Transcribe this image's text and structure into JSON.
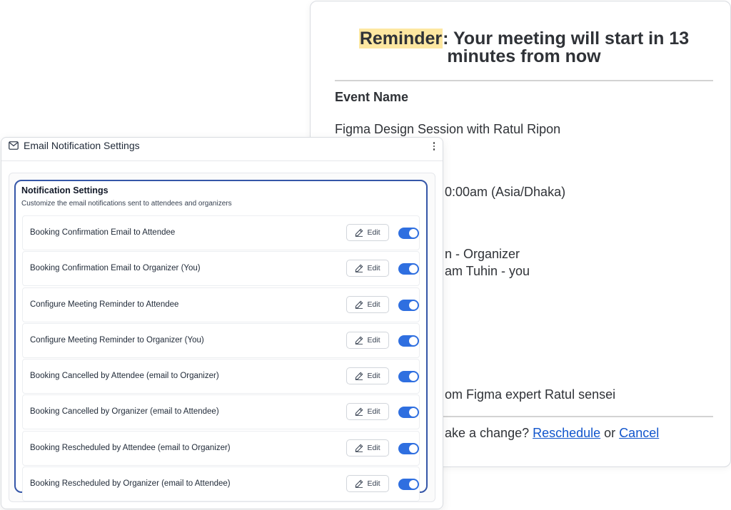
{
  "email_preview": {
    "heading_highlight": "Reminder",
    "heading_rest": ": Your meeting will start in 13",
    "heading_line2": "minutes from now",
    "event_label": "Event Name",
    "event_value": "Figma Design Session with Ratul Ripon",
    "time_fragment": "0:00am (Asia/Dhaka)",
    "organizer_fragment": "n - Organizer",
    "attendee_fragment": "am Tuhin - you",
    "description_fragment": "om Figma expert Ratul sensei",
    "change_prefix": "ake a change? ",
    "reschedule_link": "Reschedule",
    "or_text": " or ",
    "cancel_link": "Cancel",
    "highlight_color": "#fde7a1",
    "link_color": "#1155cc"
  },
  "settings_panel": {
    "title": "Email Notification Settings",
    "header_icon": "mail-icon",
    "menu_icon": "kebab-menu-icon",
    "section_title": "Notification Settings",
    "section_subtitle": "Customize the email notifications sent to attendees and organizers",
    "accent_color": "#3556a8",
    "toggle_color": "#2f6fe0",
    "edit_label": "Edit",
    "edit_icon": "pencil-icon",
    "rows": [
      {
        "label": "Booking Confirmation Email to Attendee",
        "enabled": true
      },
      {
        "label": "Booking Confirmation Email to Organizer (You)",
        "enabled": true
      },
      {
        "label": "Configure Meeting Reminder to Attendee",
        "enabled": true
      },
      {
        "label": "Configure Meeting Reminder to Organizer (You)",
        "enabled": true
      },
      {
        "label": "Booking Cancelled by Attendee (email to Organizer)",
        "enabled": true
      },
      {
        "label": "Booking Cancelled by Organizer (email to Attendee)",
        "enabled": true
      },
      {
        "label": "Booking Rescheduled by Attendee (email to Organizer)",
        "enabled": true
      },
      {
        "label": "Booking Rescheduled by Organizer (email to Attendee)",
        "enabled": true
      }
    ]
  }
}
